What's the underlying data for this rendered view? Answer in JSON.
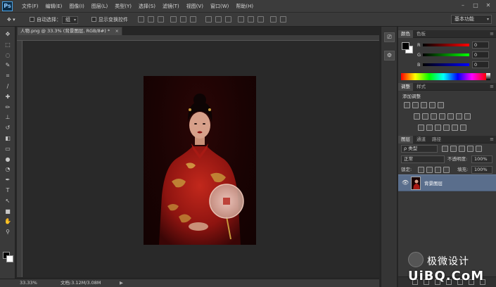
{
  "app": {
    "logo_text": "Ps"
  },
  "menu": {
    "items": [
      "文件(F)",
      "编辑(E)",
      "图像(I)",
      "图层(L)",
      "类型(Y)",
      "选择(S)",
      "滤镜(T)",
      "视图(V)",
      "窗口(W)",
      "帮助(H)"
    ]
  },
  "window_controls": [
    "–",
    "□",
    "✕"
  ],
  "options": {
    "auto_select_label": "自动选择：",
    "auto_select_value": "组",
    "show_transform_label": "显示变换控件",
    "workspace": "基本功能"
  },
  "document": {
    "tab_title": "人物.png @ 33.3% (背景图层, RGB/8#) *",
    "close_glyph": "×",
    "zoom": "33.33%",
    "doc_size": "文档:3.12M/3.08M",
    "status_arrow": "▶"
  },
  "toolbar": {
    "tools": [
      {
        "name": "move-tool",
        "glyph": "✥"
      },
      {
        "name": "marquee-tool",
        "glyph": "⬚"
      },
      {
        "name": "lasso-tool",
        "glyph": "◌"
      },
      {
        "name": "quick-select-tool",
        "glyph": "✎"
      },
      {
        "name": "crop-tool",
        "glyph": "⌗"
      },
      {
        "name": "eyedropper-tool",
        "glyph": "∕"
      },
      {
        "name": "healing-tool",
        "glyph": "✚"
      },
      {
        "name": "brush-tool",
        "glyph": "✏"
      },
      {
        "name": "stamp-tool",
        "glyph": "⊥"
      },
      {
        "name": "history-brush-tool",
        "glyph": "↺"
      },
      {
        "name": "eraser-tool",
        "glyph": "◧"
      },
      {
        "name": "gradient-tool",
        "glyph": "▭"
      },
      {
        "name": "blur-tool",
        "glyph": "●"
      },
      {
        "name": "dodge-tool",
        "glyph": "◔"
      },
      {
        "name": "pen-tool",
        "glyph": "✒"
      },
      {
        "name": "type-tool",
        "glyph": "T"
      },
      {
        "name": "path-select-tool",
        "glyph": "↖"
      },
      {
        "name": "shape-tool",
        "glyph": "■"
      },
      {
        "name": "hand-tool",
        "glyph": "✋"
      },
      {
        "name": "zoom-tool",
        "glyph": "⚲"
      }
    ]
  },
  "panels": {
    "color_tabs": [
      "颜色",
      "色板"
    ],
    "sliders": [
      {
        "label": "R",
        "value": "0"
      },
      {
        "label": "G",
        "value": "0"
      },
      {
        "label": "B",
        "value": "0"
      }
    ],
    "adjust_tabs": [
      "调整",
      "样式"
    ],
    "adjust_title": "添加调整",
    "layers_tabs": [
      "图层",
      "通道",
      "路径"
    ],
    "kind_filter": "ρ 类型",
    "blend_mode": "正常",
    "opacity_label": "不透明度:",
    "opacity_value": "100%",
    "lock_label": "锁定:",
    "fill_label": "填充:",
    "fill_value": "100%",
    "layer_name": "背景图层",
    "eye_glyph": "👁"
  },
  "watermark": {
    "brand": "极微设计",
    "site": "UiBQ.CoM"
  }
}
